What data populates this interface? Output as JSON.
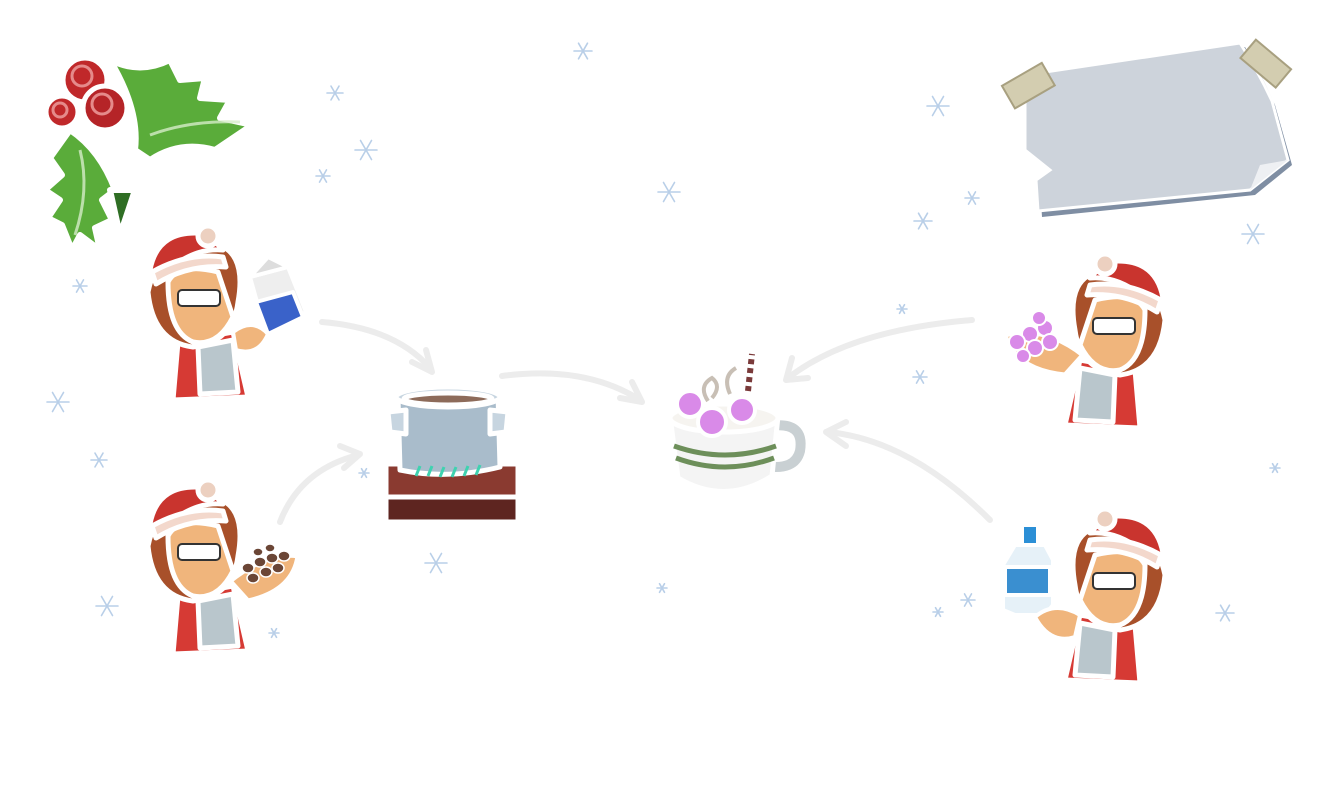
{
  "scene": {
    "background": "#ffffff",
    "theme": "christmas hot chocolate recipe",
    "decoration": "holly-icon",
    "snowflake_color": "#b9cfe8",
    "note_card": {
      "text": "",
      "color": "#cdd3db",
      "tape_color": "#d3cdb0"
    }
  },
  "characters": [
    {
      "id": "chef-milk",
      "holding": "milk-carton-icon"
    },
    {
      "id": "chef-chocolate",
      "holding": "chocolate-chips-icon"
    },
    {
      "id": "chef-marshmallow",
      "holding": "marshmallows-icon"
    },
    {
      "id": "chef-water",
      "holding": "water-bottle-icon"
    }
  ],
  "stations": {
    "stove": {
      "icon": "pot-on-stove-icon"
    },
    "result": {
      "icon": "hot-chocolate-mug-icon"
    }
  },
  "colors": {
    "hat_red": "#c9342e",
    "skin": "#f0b57c",
    "hair": "#a8502a",
    "apron": "#b9c6cc",
    "holly_green": "#5aac3a",
    "berry_red": "#c0282a",
    "stove_red": "#8a3a30",
    "marshmallow": "#d98ae8",
    "mug_green": "#6d8f5a",
    "arrow": "#ececec"
  }
}
